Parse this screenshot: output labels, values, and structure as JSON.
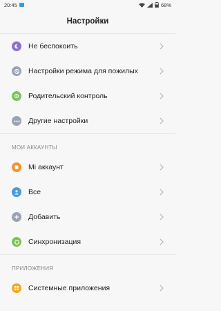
{
  "statusbar": {
    "time": "20:45",
    "battery": "68%"
  },
  "header": {
    "title": "Настройки"
  },
  "group1": [
    {
      "id": "dnd",
      "label": "Не беспокоить",
      "icon": "moon-icon",
      "color": "#8e6fc9"
    },
    {
      "id": "elderly",
      "label": "Настройки режима для пожилых",
      "icon": "no-sign-icon",
      "color": "#9aa3b5"
    },
    {
      "id": "parental",
      "label": "Родительский контроль",
      "icon": "shield-icon",
      "color": "#7ec257"
    },
    {
      "id": "other",
      "label": "Другие настройки",
      "icon": "more-icon",
      "color": "#9aa3b5"
    }
  ],
  "accounts": {
    "title": "МОИ АККАУНТЫ",
    "items": [
      {
        "id": "mi",
        "label": "Mi аккаунт",
        "icon": "mi-icon",
        "color": "#f5922e"
      },
      {
        "id": "all",
        "label": "Все",
        "icon": "person-icon",
        "color": "#4a9bdc"
      },
      {
        "id": "add",
        "label": "Добавить",
        "icon": "plus-icon",
        "color": "#9aa3b5"
      },
      {
        "id": "sync",
        "label": "Синхронизация",
        "icon": "sync-icon",
        "color": "#7ec257"
      }
    ]
  },
  "apps": {
    "title": "ПРИЛОЖЕНИЯ",
    "items": [
      {
        "id": "system-apps",
        "label": "Системные приложения",
        "icon": "apps-icon",
        "color": "#f5a623"
      }
    ]
  }
}
